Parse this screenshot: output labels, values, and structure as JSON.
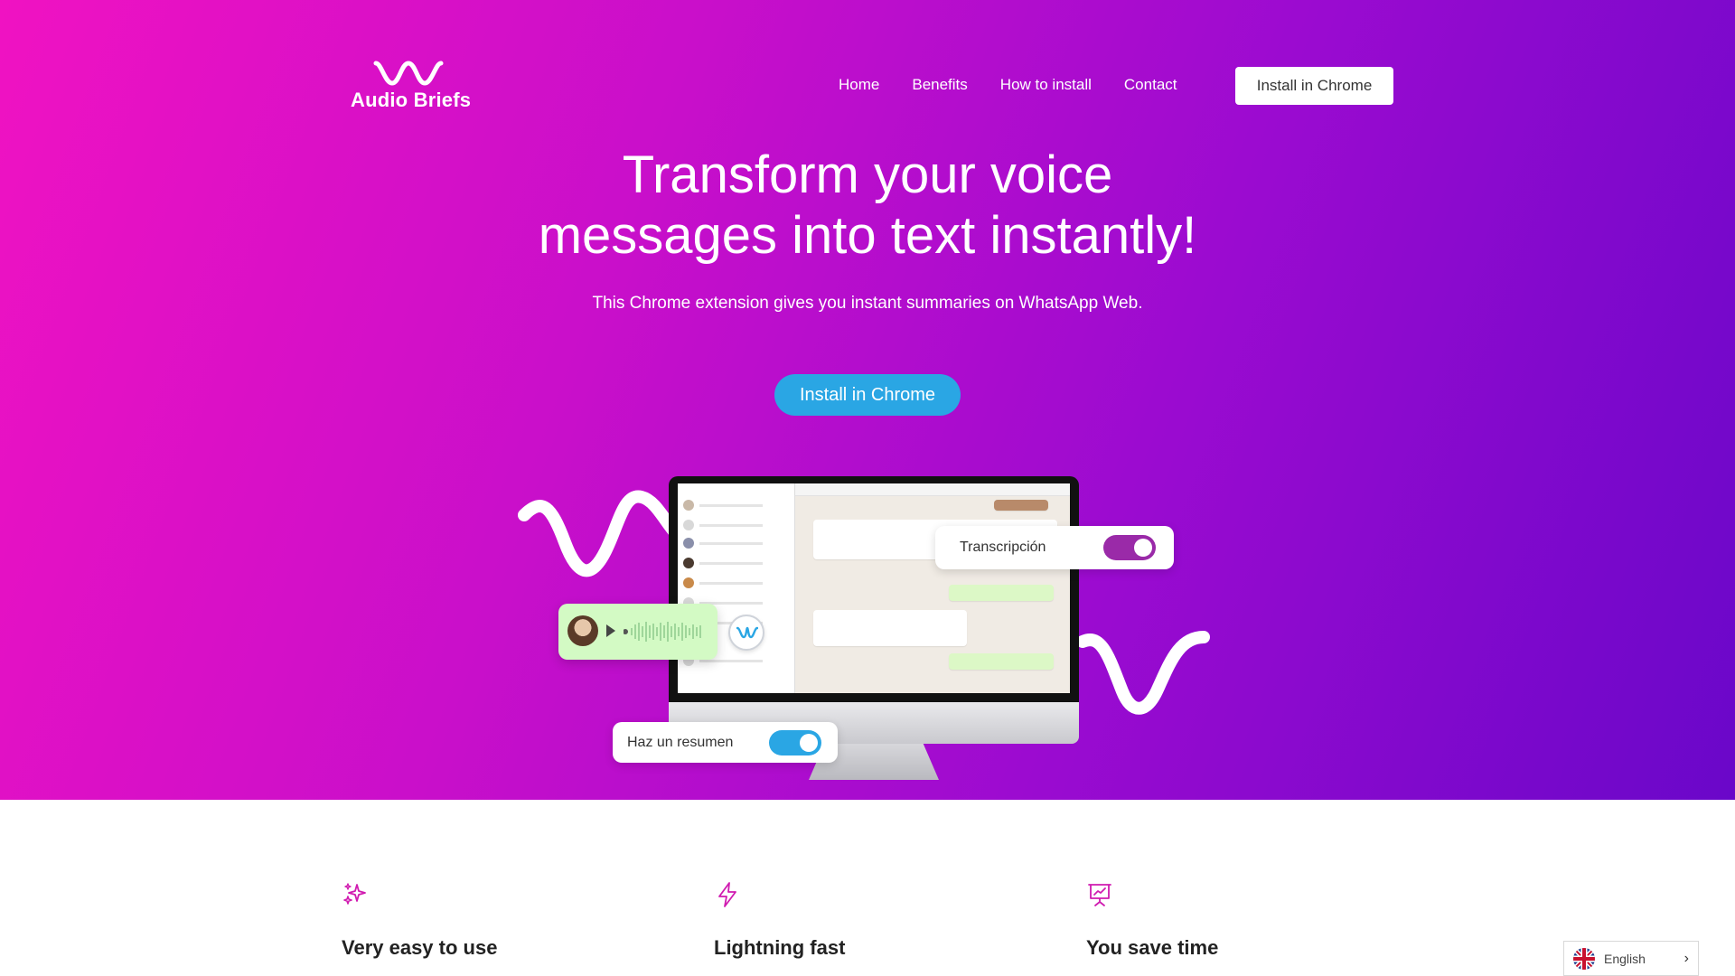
{
  "brand": {
    "name": "Audio Briefs"
  },
  "nav": {
    "items": [
      "Home",
      "Benefits",
      "How to install",
      "Contact"
    ],
    "cta": "Install in Chrome"
  },
  "hero": {
    "title_line1": "Transform your voice",
    "title_line2": "messages into text instantly!",
    "subtitle": "This Chrome extension gives you instant summaries on WhatsApp Web.",
    "cta": "Install in Chrome"
  },
  "illustration": {
    "toggle_transcription": "Transcripción",
    "toggle_summary": "Haz un resumen"
  },
  "features": [
    {
      "icon": "sparkles-icon",
      "title": "Very easy to use"
    },
    {
      "icon": "lightning-icon",
      "title": "Lightning fast"
    },
    {
      "icon": "presentation-chart-icon",
      "title": "You save time"
    }
  ],
  "language": {
    "label": "English",
    "flag": "uk-flag-icon"
  },
  "colors": {
    "hero_gradient_start": "#f012c2",
    "hero_gradient_end": "#6a07c9",
    "cta_blue": "#2aa6e4",
    "accent_magenta": "#d01bb0",
    "toggle_purple": "#9a2aa8",
    "toggle_blue": "#2aa6e4"
  }
}
